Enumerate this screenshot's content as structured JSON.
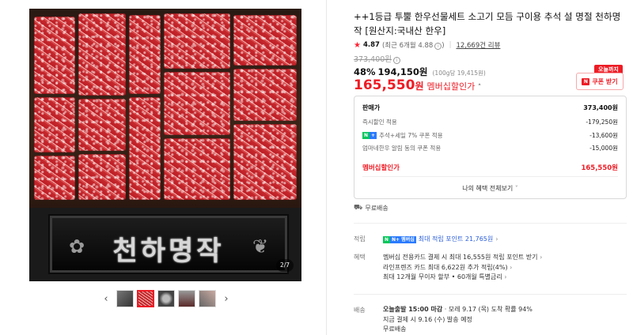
{
  "product": {
    "title": "++1등급 투뿔 한우선물세트 소고기 모듬 구이용 추석 설 명절 천하명작 [원산지:국내산 한우]",
    "rating": "4.87",
    "rating_detail": "(최근 6개월 4.88",
    "review_count": "12,669건 리뷰",
    "original_price": "373,400원",
    "discount_rate": "48%",
    "sale_price": "194,150원",
    "unit_price": "(100g당 19,415원)",
    "member_price_number": "165,550",
    "member_price_won": "원",
    "member_price_label": "멤버십할인가",
    "today_badge": "오늘까지",
    "coupon_label": "쿠폰 받기",
    "coupon_icon_text": "N"
  },
  "gallery": {
    "plaque_text": "천하명작",
    "counter": "2/7",
    "prev_symbol": "‹",
    "next_symbol": "›"
  },
  "benefits": {
    "rows": [
      {
        "label": "판매가",
        "value": "373,400원"
      },
      {
        "label": "즉시할인 적용",
        "value": "-179,250원"
      },
      {
        "label": "추석+세일 7% 쿠폰 적용",
        "value": "-13,600원"
      },
      {
        "label": "엄마네한우 알림 동의 쿠폰 적용",
        "value": "-15,000원"
      }
    ],
    "total_label": "멤버십할인가",
    "total_value": "165,550원",
    "more_label": "나의 혜택 전체보기",
    "badge_n": "N",
    "badge_plus": "+"
  },
  "shipping_short": "무료배송",
  "points": {
    "label": "적립",
    "badge_text": "N+ 멤버십",
    "text": "최대 적립 포인트 21,765원"
  },
  "perks": {
    "label": "혜택",
    "lines": [
      "멤버십 전용카드 결제 시 최대 16,555원 적립 포인트 받기",
      "라인프렌즈 카드 최대 6,622원 추가 적립(4%)",
      "최대 12개월 무이자 할부 • 60개월 특별금리"
    ]
  },
  "delivery": {
    "label": "배송",
    "line1_bold": "오늘출발 15:00 마감",
    "line1_rest": " · 모레 9.17 (목) 도착 확률 94%",
    "line2": "지금 결제 시 9.16 (수) 발송 예정",
    "line3": "무료배송"
  },
  "colors": {
    "accent": "#ee1c25",
    "naver_green": "#03c75a",
    "point_blue": "#2b5fd9"
  }
}
